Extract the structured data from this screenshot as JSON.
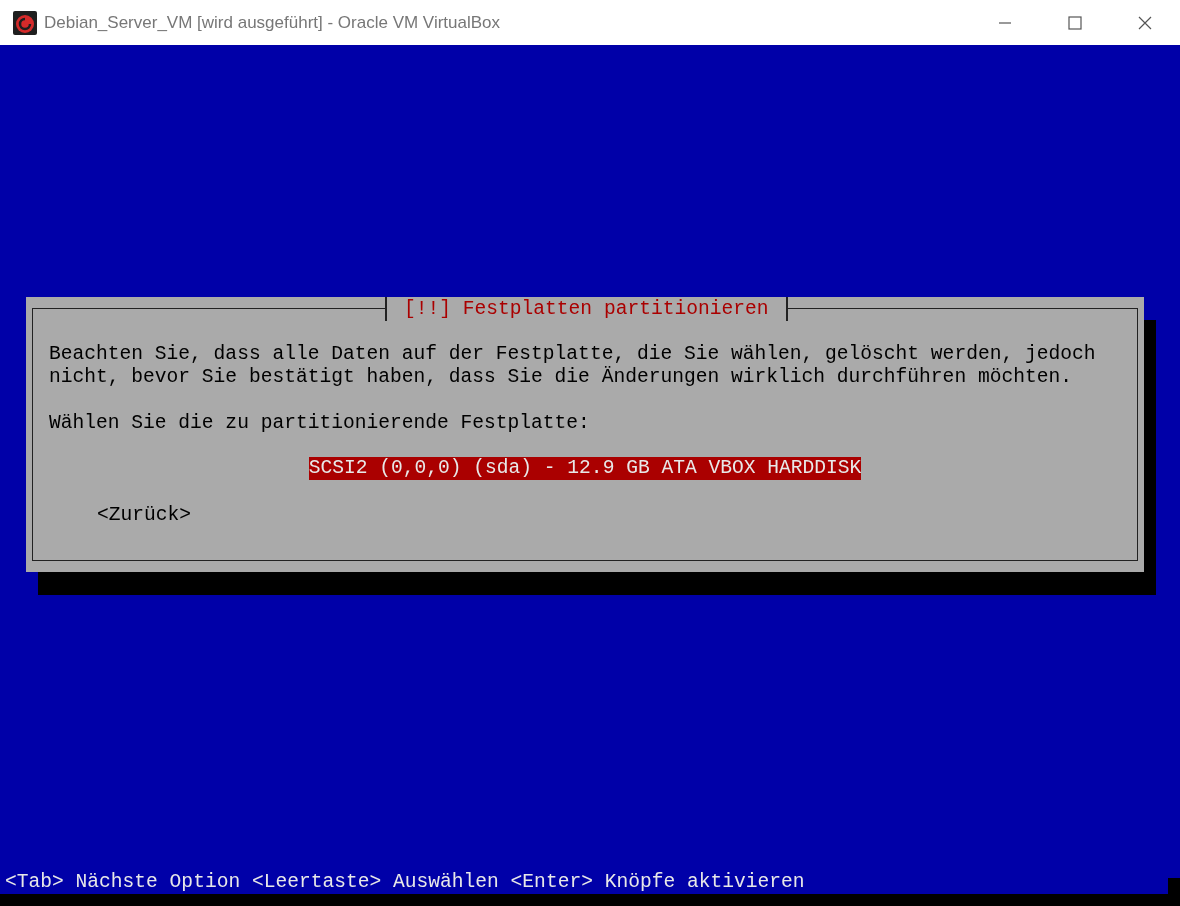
{
  "window": {
    "title": "Debian_Server_VM [wird ausgeführt] - Oracle VM VirtualBox"
  },
  "dialog": {
    "title": "[!!] Festplatten partitionieren",
    "message": "Beachten Sie, dass alle Daten auf der Festplatte, die Sie wählen, gelöscht werden, jedoch nicht, bevor Sie bestätigt haben, dass Sie die Änderungen wirklich durchführen möchten.",
    "prompt": "Wählen Sie die zu partitionierende Festplatte:",
    "options": [
      {
        "label": "SCSI2 (0,0,0) (sda) - 12.9 GB ATA VBOX HARDDISK",
        "selected": true
      }
    ],
    "buttons": [
      {
        "label": "<Zurück>",
        "selected": false
      }
    ]
  },
  "status_bar": "<Tab> Nächste Option <Leertaste> Auswählen <Enter> Knöpfe aktivieren"
}
